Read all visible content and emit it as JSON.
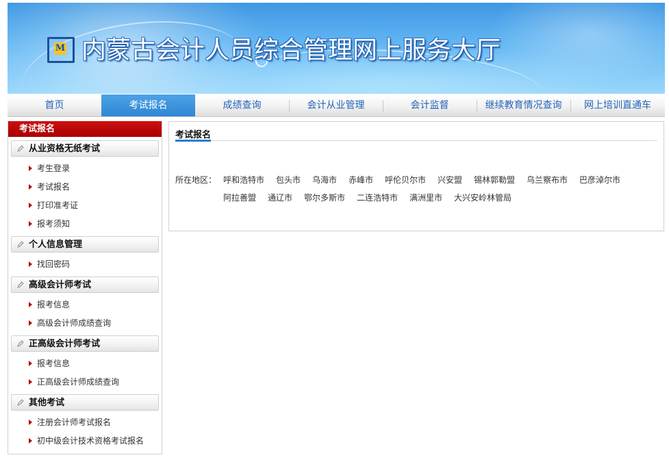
{
  "banner": {
    "title": "内蒙古会计人员综合管理网上服务大厅",
    "logo_text": "M"
  },
  "nav": {
    "items": [
      {
        "label": "首页"
      },
      {
        "label": "考试报名",
        "active": true
      },
      {
        "label": "成绩查询"
      },
      {
        "label": "会计从业管理"
      },
      {
        "label": "会计监督"
      },
      {
        "label": "继续教育情况查询"
      },
      {
        "label": "网上培训直通车"
      }
    ]
  },
  "sidebar": {
    "header": "考试报名",
    "groups": [
      {
        "title": "从业资格无纸考试",
        "links": [
          "考生登录",
          "考试报名",
          "打印准考证",
          "报考须知"
        ]
      },
      {
        "title": "个人信息管理",
        "links": [
          "找回密码"
        ]
      },
      {
        "title": "高级会计师考试",
        "links": [
          "报考信息",
          "高级会计师成绩查询"
        ]
      },
      {
        "title": "正高级会计师考试",
        "links": [
          "报考信息",
          "正高级会计师成绩查询"
        ]
      },
      {
        "title": "其他考试",
        "links": [
          "注册会计师考试报名",
          "初中级会计技术资格考试报名"
        ]
      }
    ]
  },
  "content": {
    "title": "考试报名",
    "region_label": "所在地区：",
    "cities_row1": [
      "呼和浩特市",
      "包头市",
      "乌海市",
      "赤峰市",
      "呼伦贝尔市",
      "兴安盟",
      "锡林郭勒盟",
      "乌兰察布市",
      "巴彦淖尔市"
    ],
    "cities_row2": [
      "阿拉善盟",
      "通辽市",
      "鄂尔多斯市",
      "二连浩特市",
      "满洲里市",
      "大兴安岭林管局"
    ]
  },
  "colors": {
    "accent": "#2c7bd0",
    "sidebar_header": "#b30000",
    "nav_text": "#2163b8"
  }
}
